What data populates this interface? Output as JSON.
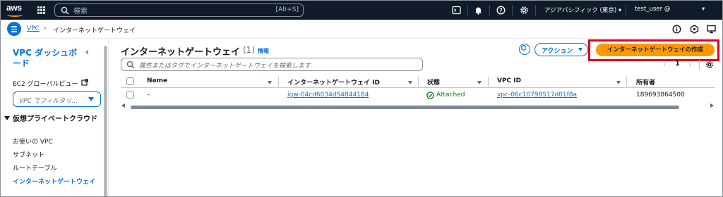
{
  "topnav": {
    "logo_text": "aws",
    "search": {
      "placeholder": "検索",
      "shortcut": "[Alt+S]"
    },
    "region": "アジアパシフィック (東京) ▾",
    "user": "test_user @",
    "user_caret": "▾"
  },
  "breadcrumb": {
    "root": "VPC",
    "separator": "›",
    "current": "インターネットゲートウェイ"
  },
  "sidebar": {
    "title": "VPC ダッシュボード",
    "close_glyph": "‹",
    "ec2_global_view": "EC2 グローバルビュー",
    "filter_placeholder": "VPC でフィルタリ...",
    "section_title": "仮想プライベートクラウド",
    "items": [
      {
        "label": "お使いの VPC",
        "active": false
      },
      {
        "label": "サブネット",
        "active": false
      },
      {
        "label": "ルートテーブル",
        "active": false
      },
      {
        "label": "インターネットゲートウェイ",
        "active": true
      }
    ]
  },
  "main": {
    "title": "インターネットゲートウェイ",
    "count": "(1)",
    "info": "情報",
    "actions_label": "アクション",
    "create_label": "インターネットゲートウェイの作成",
    "table_search_placeholder": "属性またはタグでインターネットゲートウェイを検索します",
    "pager": {
      "prev": "‹",
      "page": "1",
      "next": "›"
    },
    "columns": [
      "Name",
      "インターネットゲートウェイ ID",
      "状態",
      "VPC ID",
      "所有者"
    ],
    "rows": [
      {
        "name": "–",
        "igw_id": "igw-04cd6034d54844184",
        "state": "Attached",
        "vpc_id": "vpc-06c10798517d01f8a",
        "owner": "189693864500"
      }
    ]
  },
  "colors": {
    "nav_bg": "#0f1b2a",
    "link": "#0972d3",
    "primary_button": "#ff9900",
    "highlight": "#e4001a",
    "success": "#037f0c"
  },
  "icons": [
    "aws-logo",
    "apps-grid-icon",
    "search-icon",
    "cloudshell-icon",
    "bell-icon",
    "help-icon",
    "gear-icon",
    "menu-icon",
    "info-icon",
    "notifications-icon",
    "feedback-icon",
    "external-link-icon",
    "refresh-icon",
    "check-circle-icon"
  ]
}
